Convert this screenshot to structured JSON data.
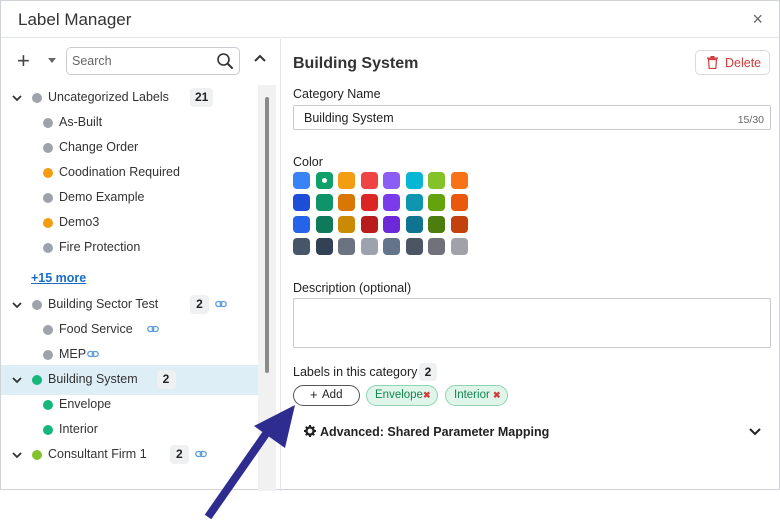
{
  "window": {
    "title": "Label Manager",
    "close_glyph": "×"
  },
  "left": {
    "add_glyph": "+",
    "search_placeholder": "Search",
    "more_link": "+15 more",
    "tree": [
      {
        "label": "Uncategorized Labels",
        "count": "21",
        "color": "#9ea3ab",
        "level": 0,
        "expanded": true
      },
      {
        "label": "As-Built",
        "color": "#9ea3ab",
        "level": 1
      },
      {
        "label": "Change Order",
        "color": "#9ea3ab",
        "level": 1
      },
      {
        "label": "Coodination Required",
        "color": "#f29d12",
        "level": 1
      },
      {
        "label": "Demo Example",
        "color": "#9ea3ab",
        "level": 1
      },
      {
        "label": "Demo3",
        "color": "#f29d12",
        "level": 1
      },
      {
        "label": "Fire Protection",
        "color": "#9ea3ab",
        "level": 1
      },
      {
        "label": "Building Sector Test",
        "count": "2",
        "color": "#9ea3ab",
        "level": 0,
        "expanded": true,
        "linked": true
      },
      {
        "label": "Food Service",
        "color": "#9ea3ab",
        "level": 1,
        "linked": true
      },
      {
        "label": "MEP",
        "color": "#9ea3ab",
        "level": 1,
        "linked": true
      },
      {
        "label": "Building System",
        "count": "2",
        "color": "#16b77a",
        "level": 0,
        "expanded": true,
        "selected": true
      },
      {
        "label": "Envelope",
        "color": "#16b77a",
        "level": 1
      },
      {
        "label": "Interior",
        "color": "#16b77a",
        "level": 1
      },
      {
        "label": "Consultant Firm 1",
        "count": "2",
        "color": "#84c22a",
        "level": 0,
        "expanded": true,
        "linked": true
      }
    ]
  },
  "detail": {
    "title": "Building System",
    "delete_label": "Delete",
    "category_name_label": "Category Name",
    "category_name_value": "Building System",
    "char_count": "15/30",
    "color_label": "Color",
    "selected_color": "#10a06a",
    "palette": [
      [
        "#3b82f6",
        "#10a06a",
        "#f29d12",
        "#ef4444",
        "#8b5cf6",
        "#06b6d4",
        "#84c22a",
        "#f97316"
      ],
      [
        "#1d4ed8",
        "#0e9468",
        "#d97706",
        "#dc2626",
        "#7c3aed",
        "#0e96b0",
        "#65a30d",
        "#ea580c"
      ],
      [
        "#2563eb",
        "#0f7a5a",
        "#ca8a04",
        "#b91c1c",
        "#6d28d9",
        "#0e7490",
        "#4d7c0f",
        "#c2410c"
      ],
      [
        "#475569",
        "#334155",
        "#6b7280",
        "#9ca3af",
        "#64748b",
        "#4b5563",
        "#71717a",
        "#a1a1aa"
      ]
    ],
    "description_label": "Description (optional)",
    "description_value": "",
    "labels_heading": "Labels in this category",
    "labels_count": "2",
    "add_label": "Add",
    "add_glyph": "+",
    "chips": [
      {
        "label": "Envelope",
        "remove_glyph": "✖"
      },
      {
        "label": "Interior",
        "remove_glyph": "✖"
      }
    ],
    "advanced_label": "Advanced: Shared Parameter Mapping"
  },
  "colors": {
    "accent_blue": "#1a6fc4",
    "selected_row_bg": "#ddeef7",
    "delete_red": "#d23c3c",
    "chip_green": "#14864f",
    "annotation_arrow": "#2e2d8f"
  },
  "icons": [
    "close-icon",
    "plus-icon",
    "caret-down-icon",
    "search-icon",
    "chevron-up-icon",
    "chevron-down-icon",
    "link-icon",
    "trash-icon",
    "gear-icon",
    "arrow-annotation"
  ]
}
